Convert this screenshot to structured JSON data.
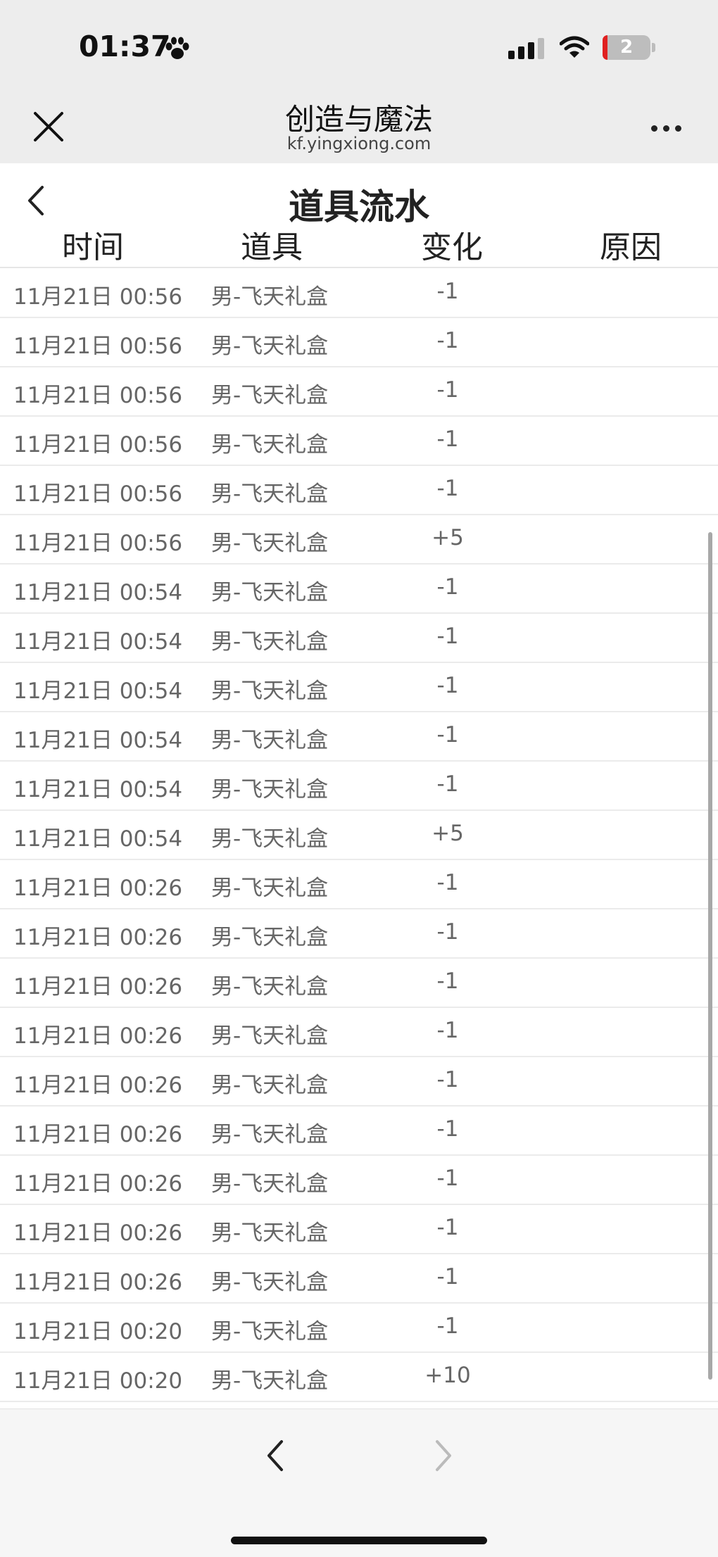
{
  "status_bar": {
    "time": "01:37",
    "battery": "2"
  },
  "browser": {
    "title": "创造与魔法",
    "url": "kf.yingxiong.com"
  },
  "page": {
    "title": "道具流水"
  },
  "table": {
    "headers": {
      "time": "时间",
      "item": "道具",
      "change": "变化",
      "reason": "原因"
    },
    "rows": [
      {
        "time": "11月21日 00:56",
        "item": "男-飞天礼盒",
        "change": "-1",
        "reason": ""
      },
      {
        "time": "11月21日 00:56",
        "item": "男-飞天礼盒",
        "change": "-1",
        "reason": ""
      },
      {
        "time": "11月21日 00:56",
        "item": "男-飞天礼盒",
        "change": "-1",
        "reason": ""
      },
      {
        "time": "11月21日 00:56",
        "item": "男-飞天礼盒",
        "change": "-1",
        "reason": ""
      },
      {
        "time": "11月21日 00:56",
        "item": "男-飞天礼盒",
        "change": "-1",
        "reason": ""
      },
      {
        "time": "11月21日 00:56",
        "item": "男-飞天礼盒",
        "change": "+5",
        "reason": ""
      },
      {
        "time": "11月21日 00:54",
        "item": "男-飞天礼盒",
        "change": "-1",
        "reason": ""
      },
      {
        "time": "11月21日 00:54",
        "item": "男-飞天礼盒",
        "change": "-1",
        "reason": ""
      },
      {
        "time": "11月21日 00:54",
        "item": "男-飞天礼盒",
        "change": "-1",
        "reason": ""
      },
      {
        "time": "11月21日 00:54",
        "item": "男-飞天礼盒",
        "change": "-1",
        "reason": ""
      },
      {
        "time": "11月21日 00:54",
        "item": "男-飞天礼盒",
        "change": "-1",
        "reason": ""
      },
      {
        "time": "11月21日 00:54",
        "item": "男-飞天礼盒",
        "change": "+5",
        "reason": ""
      },
      {
        "time": "11月21日 00:26",
        "item": "男-飞天礼盒",
        "change": "-1",
        "reason": ""
      },
      {
        "time": "11月21日 00:26",
        "item": "男-飞天礼盒",
        "change": "-1",
        "reason": ""
      },
      {
        "time": "11月21日 00:26",
        "item": "男-飞天礼盒",
        "change": "-1",
        "reason": ""
      },
      {
        "time": "11月21日 00:26",
        "item": "男-飞天礼盒",
        "change": "-1",
        "reason": ""
      },
      {
        "time": "11月21日 00:26",
        "item": "男-飞天礼盒",
        "change": "-1",
        "reason": ""
      },
      {
        "time": "11月21日 00:26",
        "item": "男-飞天礼盒",
        "change": "-1",
        "reason": ""
      },
      {
        "time": "11月21日 00:26",
        "item": "男-飞天礼盒",
        "change": "-1",
        "reason": ""
      },
      {
        "time": "11月21日 00:26",
        "item": "男-飞天礼盒",
        "change": "-1",
        "reason": ""
      },
      {
        "time": "11月21日 00:26",
        "item": "男-飞天礼盒",
        "change": "-1",
        "reason": ""
      },
      {
        "time": "11月21日 00:20",
        "item": "男-飞天礼盒",
        "change": "-1",
        "reason": ""
      },
      {
        "time": "11月21日 00:20",
        "item": "男-飞天礼盒",
        "change": "+10",
        "reason": ""
      }
    ]
  },
  "icons": {
    "paw": "paw-icon",
    "signal": "cellular-signal-icon",
    "wifi": "wifi-icon",
    "close": "close-icon",
    "more": "more-dots-icon",
    "back": "chevron-left-icon",
    "nav_back": "chevron-left-icon",
    "nav_forward": "chevron-right-icon"
  },
  "colors": {
    "bar_bg": "#ededed",
    "battery_low": "#e02020",
    "text": "#222222",
    "muted": "#666666"
  }
}
